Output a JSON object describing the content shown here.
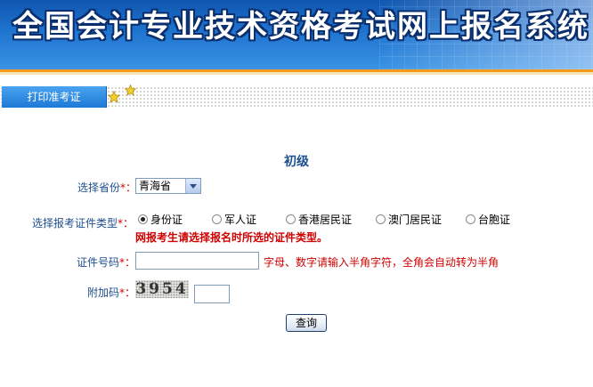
{
  "banner": {
    "title": "全国会计专业技术资格考试网上报名系统"
  },
  "tabs": [
    {
      "label": "打印准考证"
    }
  ],
  "form": {
    "level_title": "初级",
    "province_label": "选择省份",
    "province_value": "青海省",
    "id_type_label": "选择报考证件类型",
    "id_types": [
      "身份证",
      "军人证",
      "香港居民证",
      "澳门居民证",
      "台胞证"
    ],
    "id_type_selected": "身份证",
    "id_type_note": "网报考生请选择报名时所选的证件类型。",
    "id_number_label": "证件号码",
    "id_number_value": "",
    "id_number_hint": "字母、数字请输入半角字符，全角会自动转为半角",
    "captcha_label": "附加码",
    "captcha_text": "3954",
    "captcha_value": "",
    "required_mark": "*：",
    "submit_label": "查询"
  },
  "colors": {
    "banner_blue": "#1f74cf",
    "label_blue": "#1e4f8e",
    "required_red": "#d00000",
    "accent_orange": "#f29a1c"
  }
}
